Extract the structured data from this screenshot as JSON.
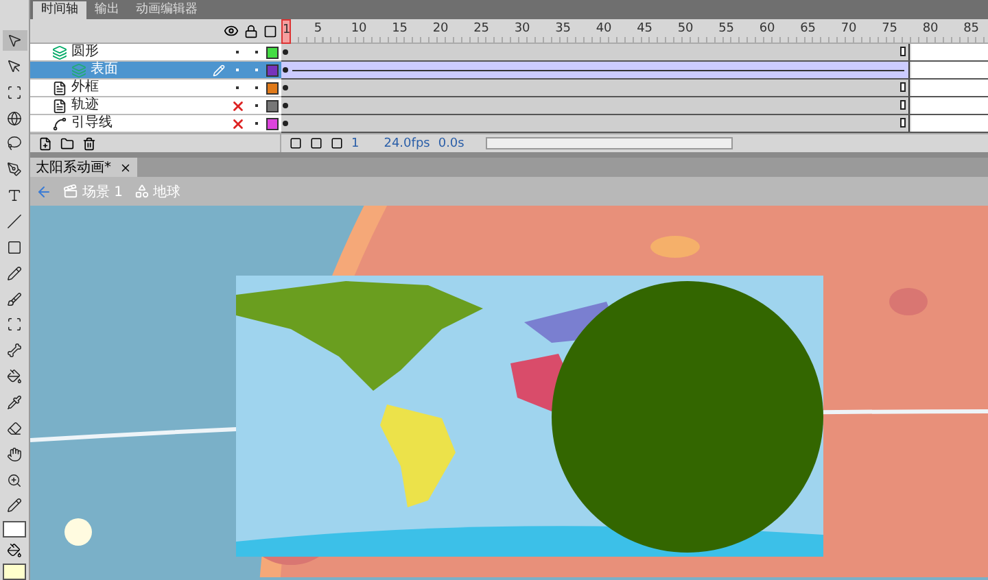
{
  "tabs": [
    {
      "label": "时间轴",
      "selected": true
    },
    {
      "label": "输出",
      "selected": false
    },
    {
      "label": "动画编辑器",
      "selected": false
    }
  ],
  "frame_ruler": [
    "1",
    "5",
    "10",
    "15",
    "20",
    "25",
    "30",
    "35",
    "40",
    "45",
    "50",
    "55",
    "60",
    "65",
    "70",
    "75",
    "80",
    "85"
  ],
  "layers": [
    {
      "name": "圆形",
      "kind": "mask",
      "visible": true,
      "color": "#44dd44",
      "selected": false,
      "tween": false,
      "children": [
        {
          "name": "表面",
          "kind": "masked",
          "visible": true,
          "color": "#7733bb",
          "selected": true,
          "tween": true
        }
      ]
    },
    {
      "name": "外框",
      "kind": "normal",
      "visible": true,
      "color": "#e07a1a",
      "selected": false,
      "tween": false
    },
    {
      "name": "轨迹",
      "kind": "normal",
      "visible": false,
      "color": "#777777",
      "selected": false,
      "tween": false
    },
    {
      "name": "引导线",
      "kind": "guide",
      "visible": false,
      "color": "#dd44dd",
      "selected": false,
      "tween": false
    }
  ],
  "timeline_status": {
    "current_frame": "1",
    "frame_rate": "24.0fps",
    "elapsed": "0.0s"
  },
  "document_tab": {
    "title": "太阳系动画*"
  },
  "breadcrumb": [
    {
      "label": "场景 1",
      "kind": "scene"
    },
    {
      "label": "地球",
      "kind": "symbol"
    }
  ]
}
